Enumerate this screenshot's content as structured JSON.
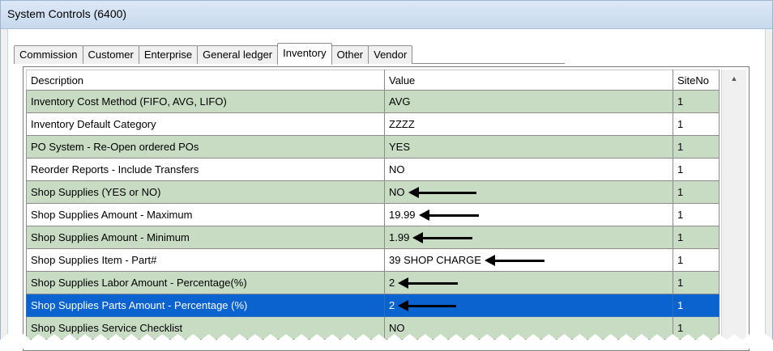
{
  "window": {
    "title": "System Controls (6400)"
  },
  "tabs": [
    {
      "label": "Commission",
      "active": false
    },
    {
      "label": "Customer",
      "active": false
    },
    {
      "label": "Enterprise",
      "active": false
    },
    {
      "label": "General ledger",
      "active": false
    },
    {
      "label": "Inventory",
      "active": true
    },
    {
      "label": "Other",
      "active": false
    },
    {
      "label": "Vendor",
      "active": false
    }
  ],
  "grid": {
    "columns": [
      "Description",
      "Value",
      "SiteNo"
    ],
    "rows": [
      {
        "description": "Inventory Cost Method (FIFO, AVG, LIFO)",
        "value": "AVG",
        "site": "1",
        "style": "green",
        "arrow": false
      },
      {
        "description": "Inventory Default Category",
        "value": "ZZZZ",
        "site": "1",
        "style": "white",
        "arrow": false
      },
      {
        "description": "PO System - Re-Open ordered POs",
        "value": "YES",
        "site": "1",
        "style": "green",
        "arrow": false
      },
      {
        "description": "Reorder Reports - Include Transfers",
        "value": "NO",
        "site": "1",
        "style": "white",
        "arrow": false
      },
      {
        "description": "Shop Supplies (YES or NO)",
        "value": "NO",
        "site": "1",
        "style": "green",
        "arrow": true
      },
      {
        "description": "Shop Supplies Amount - Maximum",
        "value": "19.99",
        "site": "1",
        "style": "white",
        "arrow": true
      },
      {
        "description": "Shop Supplies Amount - Minimum",
        "value": "1.99",
        "site": "1",
        "style": "green",
        "arrow": true
      },
      {
        "description": "Shop Supplies Item - Part#",
        "value": "39 SHOP CHARGE",
        "site": "1",
        "style": "white",
        "arrow": true
      },
      {
        "description": "Shop Supplies Labor Amount - Percentage(%)",
        "value": "2",
        "site": "1",
        "style": "green",
        "arrow": true
      },
      {
        "description": "Shop Supplies Parts Amount - Percentage (%)",
        "value": "2",
        "site": "1",
        "style": "selected",
        "arrow": true
      },
      {
        "description": "Shop Supplies Service Checklist",
        "value": "NO",
        "site": "1",
        "style": "green",
        "arrow": false
      }
    ]
  },
  "scrollbar": {
    "up_icon": "triangle-up-icon"
  }
}
